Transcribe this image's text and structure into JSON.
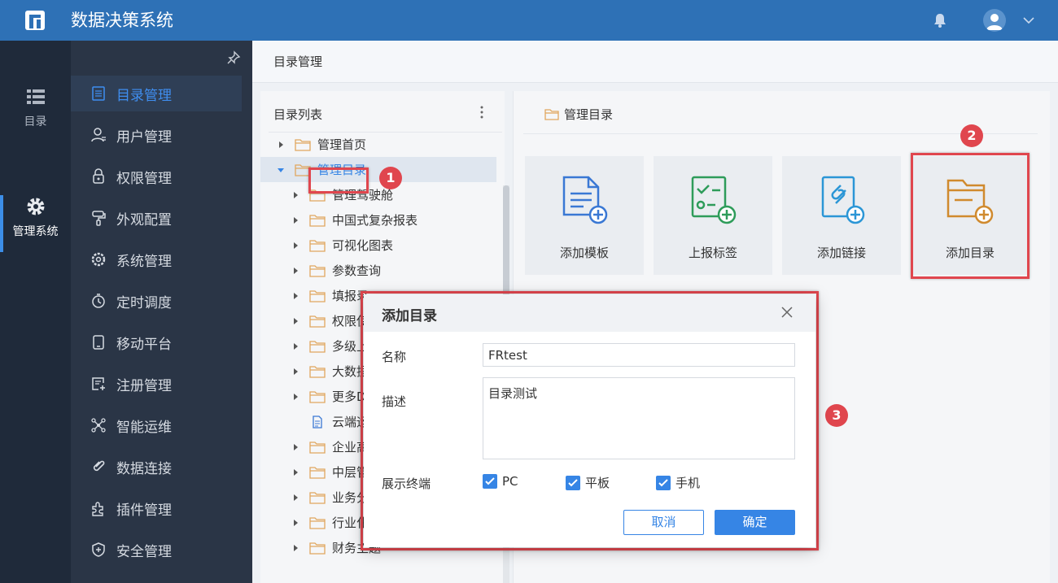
{
  "header": {
    "app_title": "数据决策系统"
  },
  "rail": {
    "items": [
      {
        "label": "目录",
        "icon": "list-icon"
      },
      {
        "label": "管理系统",
        "icon": "gear-icon"
      }
    ]
  },
  "menu": {
    "items": [
      {
        "label": "目录管理",
        "icon": "catalog-icon",
        "active": true
      },
      {
        "label": "用户管理",
        "icon": "user-icon"
      },
      {
        "label": "权限管理",
        "icon": "lock-icon"
      },
      {
        "label": "外观配置",
        "icon": "brush-icon"
      },
      {
        "label": "系统管理",
        "icon": "settings-icon"
      },
      {
        "label": "定时调度",
        "icon": "timer-icon"
      },
      {
        "label": "移动平台",
        "icon": "mobile-icon"
      },
      {
        "label": "注册管理",
        "icon": "register-icon"
      },
      {
        "label": "智能运维",
        "icon": "network-icon"
      },
      {
        "label": "数据连接",
        "icon": "link-icon"
      },
      {
        "label": "插件管理",
        "icon": "plugin-icon"
      },
      {
        "label": "安全管理",
        "icon": "shield-icon"
      }
    ]
  },
  "breadcrumb": "目录管理",
  "tree": {
    "title": "目录列表",
    "items": [
      {
        "label": "管理首页"
      },
      {
        "label": "管理目录"
      },
      {
        "label": "管理驾驶舱"
      },
      {
        "label": "中国式复杂报表"
      },
      {
        "label": "可视化图表"
      },
      {
        "label": "参数查询"
      },
      {
        "label": "填报录"
      },
      {
        "label": "权限使"
      },
      {
        "label": "多级上"
      },
      {
        "label": "大数据"
      },
      {
        "label": "更多D"
      },
      {
        "label": "云端运"
      },
      {
        "label": "企业高"
      },
      {
        "label": "中层管"
      },
      {
        "label": "业务分"
      },
      {
        "label": "行业化"
      },
      {
        "label": "财务主题"
      }
    ]
  },
  "directory": {
    "title": "管理目录",
    "cards": [
      {
        "label": "添加模板",
        "icon": "add-template-icon"
      },
      {
        "label": "上报标签",
        "icon": "report-tag-icon"
      },
      {
        "label": "添加链接",
        "icon": "add-link-icon"
      },
      {
        "label": "添加目录",
        "icon": "add-folder-icon"
      }
    ]
  },
  "annotations": [
    "1",
    "2",
    "3"
  ],
  "dialog": {
    "title": "添加目录",
    "name_label": "名称",
    "name_value": "FRtest",
    "desc_label": "描述",
    "desc_value": "目录测试",
    "terminal_label": "展示终端",
    "options": [
      {
        "label": "PC",
        "checked": true
      },
      {
        "label": "平板",
        "checked": true
      },
      {
        "label": "手机",
        "checked": true
      }
    ],
    "cancel": "取消",
    "ok": "确定"
  },
  "colors": {
    "header": "#2e71b6",
    "rail": "#1f2a3a",
    "menu": "#2a3546",
    "accent": "#3685e5",
    "highlight": "#e0464e",
    "folder": "#e0a75e"
  }
}
